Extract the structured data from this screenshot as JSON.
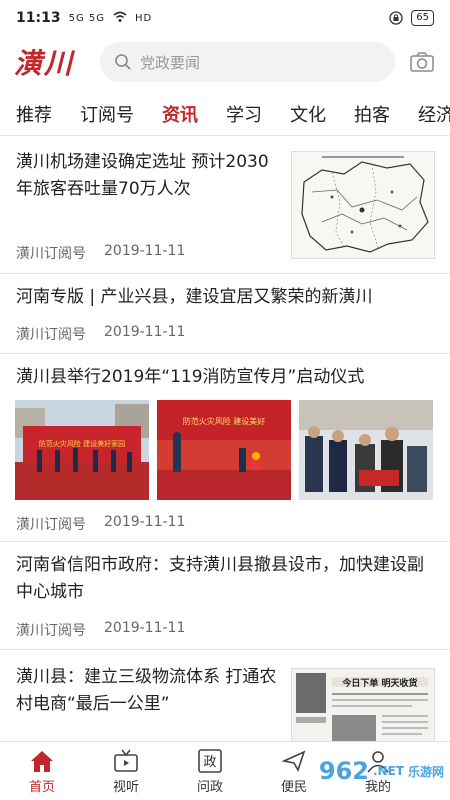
{
  "status_bar": {
    "time": "11:13",
    "signal": "5G 5G",
    "network": "HD",
    "battery": "65"
  },
  "header": {
    "logo": "潢川",
    "search_placeholder": "党政要闻"
  },
  "tabs": [
    "推荐",
    "订阅号",
    "资讯",
    "学习",
    "文化",
    "拍客",
    "经济"
  ],
  "active_tab": "资讯",
  "feed": [
    {
      "title": "潢川机场建设确定选址 预计2030年旅客吞吐量70万人次",
      "source": "潢川订阅号",
      "date": "2019-11-11"
    },
    {
      "title": "河南专版 | 产业兴县，建设宜居又繁荣的新潢川",
      "source": "潢川订阅号",
      "date": "2019-11-11"
    },
    {
      "title": "潢川县举行2019年“119消防宣传月”启动仪式",
      "source": "潢川订阅号",
      "date": "2019-11-11",
      "photo_banner_1": "防范火灾风险 建设美好家园",
      "photo_banner_2": "防范火灾风险 建设美好"
    },
    {
      "title": "河南省信阳市政府：支持潢川县撤县设市，加快建设副中心城市",
      "source": "潢川订阅号",
      "date": "2019-11-11"
    },
    {
      "title": "潢川县：建立三级物流体系 打通农村电商“最后一公里”",
      "thumb_headline": "今日下单 明天收货"
    }
  ],
  "bottom_nav": [
    {
      "label": "首页",
      "icon": "home-icon",
      "active": true
    },
    {
      "label": "视听",
      "icon": "tv-icon",
      "active": false
    },
    {
      "label": "问政",
      "icon": "zheng-icon",
      "glyph": "政",
      "active": false
    },
    {
      "label": "便民",
      "icon": "service-icon",
      "active": false
    },
    {
      "label": "我的",
      "icon": "user-icon",
      "active": false
    }
  ],
  "watermark": {
    "text": "962",
    "sub": ".NET",
    "caption": "乐游网"
  },
  "colors": {
    "brand_red": "#c1272d",
    "muted": "#666666",
    "divider": "#e6e6e6"
  }
}
